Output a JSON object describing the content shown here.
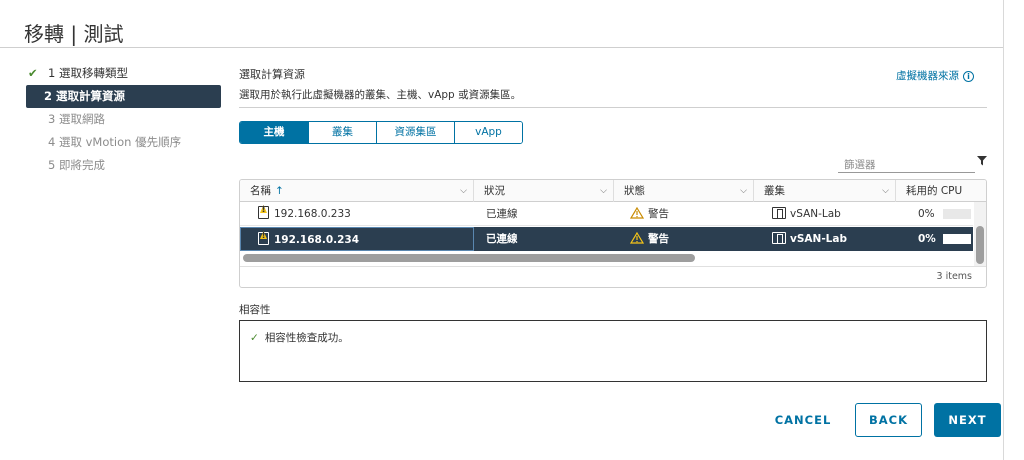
{
  "dialog": {
    "title": "移轉 | 測試"
  },
  "wizard": {
    "steps": [
      {
        "label": "1 選取移轉類型",
        "state": "done"
      },
      {
        "label": "2 選取計算資源",
        "state": "active"
      },
      {
        "label": "3 選取網路",
        "state": "pending"
      },
      {
        "label": "4 選取 vMotion 優先順序",
        "state": "pending"
      },
      {
        "label": "5 即將完成",
        "state": "pending"
      }
    ]
  },
  "main": {
    "title": "選取計算資源",
    "description": "選取用於執行此虛擬機器的叢集、主機、vApp 或資源集區。",
    "source_link": "虛擬機器來源",
    "tabs": [
      {
        "label": "主機",
        "active": true
      },
      {
        "label": "叢集",
        "active": false
      },
      {
        "label": "資源集區",
        "active": false
      },
      {
        "label": "vApp",
        "active": false
      }
    ],
    "filter_placeholder": "篩選器"
  },
  "grid": {
    "columns": [
      "名稱",
      "狀況",
      "狀態",
      "叢集",
      "耗用的 CPU"
    ],
    "sort_indicator": "↑",
    "rows": [
      {
        "name": "192.168.0.233",
        "condition": "已連線",
        "status": "警告",
        "cluster": "vSAN-Lab",
        "cpu": "0%",
        "selected": false
      },
      {
        "name": "192.168.0.234",
        "condition": "已連線",
        "status": "警告",
        "cluster": "vSAN-Lab",
        "cpu": "0%",
        "selected": true
      }
    ],
    "footer": "3 items"
  },
  "compatibility": {
    "label": "相容性",
    "message": "相容性檢查成功。"
  },
  "buttons": {
    "cancel": "CANCEL",
    "back": "BACK",
    "next": "NEXT"
  },
  "colors": {
    "accent": "#0072a3",
    "selected_row": "#2b3e50",
    "success": "#4a8a2f",
    "warning": "#f5c518"
  },
  "icons": {
    "step_done": "check-icon",
    "info": "info-icon",
    "filter": "filter-icon",
    "host_warning": "host-warning-icon",
    "status_warning": "warning-icon",
    "cluster": "cluster-icon",
    "compat_ok": "check-icon"
  }
}
